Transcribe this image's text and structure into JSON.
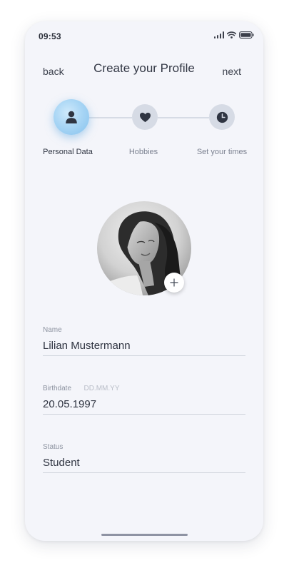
{
  "status_bar": {
    "time": "09:53",
    "icons": [
      "cellular-signal-icon",
      "wifi-icon",
      "battery-icon"
    ]
  },
  "header": {
    "back_label": "back",
    "title": "Create your Profile",
    "next_label": "next"
  },
  "steps": [
    {
      "label": "Personal Data",
      "icon": "person-icon",
      "active": true
    },
    {
      "label": "Hobbies",
      "icon": "heart-icon",
      "active": false
    },
    {
      "label": "Set your times",
      "icon": "clock-icon",
      "active": false
    }
  ],
  "profile_photo": {
    "add_icon": "plus-icon"
  },
  "form": {
    "name": {
      "label": "Name",
      "value": "Lilian Mustermann"
    },
    "birthdate": {
      "label": "Birthdate",
      "hint": "DD.MM.YY",
      "value": "20.05.1997"
    },
    "status": {
      "label": "Status",
      "value": "Student"
    }
  },
  "colors": {
    "accent": "#8fc8f0",
    "inactive": "#d6dbe5",
    "icon": "#2f3542",
    "background": "#f4f5fa"
  }
}
